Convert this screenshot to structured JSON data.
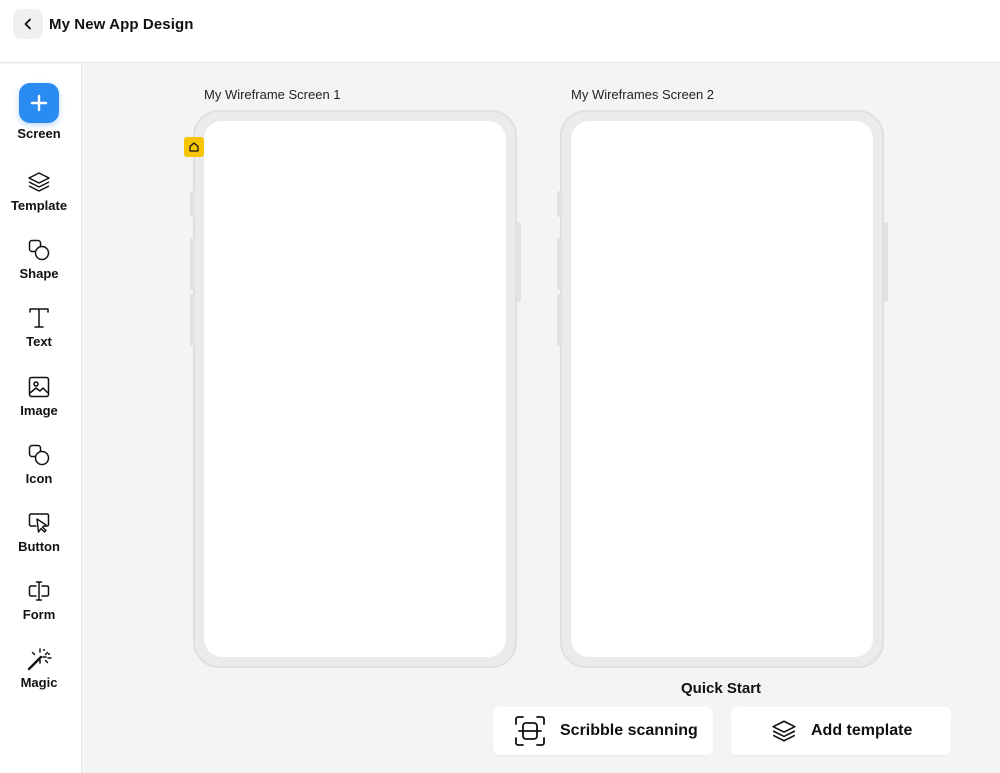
{
  "header": {
    "title": "My New App Design"
  },
  "sidebar": {
    "tools": [
      {
        "label": "Screen",
        "icon": "plus-icon"
      },
      {
        "label": "Template",
        "icon": "layers-icon"
      },
      {
        "label": "Shape",
        "icon": "shapes-icon"
      },
      {
        "label": "Text",
        "icon": "text-icon"
      },
      {
        "label": "Image",
        "icon": "image-icon"
      },
      {
        "label": "Icon",
        "icon": "icon-shapes-icon"
      },
      {
        "label": "Button",
        "icon": "cursor-click-icon"
      },
      {
        "label": "Form",
        "icon": "text-cursor-icon"
      },
      {
        "label": "Magic",
        "icon": "magic-wand-icon"
      }
    ]
  },
  "screens": [
    {
      "title": "My Wireframe Screen 1",
      "is_home": true
    },
    {
      "title": "My Wireframes Screen 2",
      "is_home": false
    }
  ],
  "quick_start": {
    "title": "Quick Start",
    "actions": [
      {
        "label": "Scribble scanning",
        "icon": "scan-icon"
      },
      {
        "label": "Add template",
        "icon": "layers-icon"
      }
    ]
  },
  "colors": {
    "accent": "#2a8bf2",
    "home_badge": "#f7c500",
    "canvas_bg": "#f4f4f4"
  }
}
